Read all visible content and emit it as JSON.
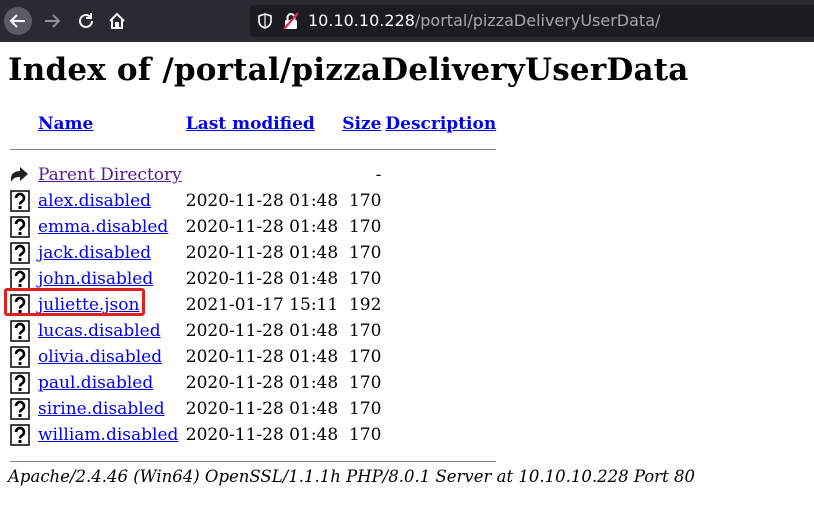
{
  "browser": {
    "url_host": "10.10.10.228",
    "url_path": "/portal/pizzaDeliveryUserData/"
  },
  "page": {
    "title": "Index of /portal/pizzaDeliveryUserData",
    "columns": {
      "name": "Name",
      "modified": "Last modified",
      "size": "Size",
      "description": "Description"
    },
    "parent": {
      "label": "Parent Directory",
      "size": "-"
    },
    "rows": [
      {
        "name": "alex.disabled",
        "modified": "2020-11-28 01:48",
        "size": "170"
      },
      {
        "name": "emma.disabled",
        "modified": "2020-11-28 01:48",
        "size": "170"
      },
      {
        "name": "jack.disabled",
        "modified": "2020-11-28 01:48",
        "size": "170"
      },
      {
        "name": "john.disabled",
        "modified": "2020-11-28 01:48",
        "size": "170"
      },
      {
        "name": "juliette.json",
        "modified": "2021-01-17 15:11",
        "size": "192"
      },
      {
        "name": "lucas.disabled",
        "modified": "2020-11-28 01:48",
        "size": "170"
      },
      {
        "name": "olivia.disabled",
        "modified": "2020-11-28 01:48",
        "size": "170"
      },
      {
        "name": "paul.disabled",
        "modified": "2020-11-28 01:48",
        "size": "170"
      },
      {
        "name": "sirine.disabled",
        "modified": "2020-11-28 01:48",
        "size": "170"
      },
      {
        "name": "william.disabled",
        "modified": "2020-11-28 01:48",
        "size": "170"
      }
    ],
    "footer": "Apache/2.4.46 (Win64) OpenSSL/1.1.1h PHP/8.0.1 Server at 10.10.10.228 Port 80"
  },
  "colors": {
    "toolbar": "#2b2a33",
    "urlbar": "#1c1b22",
    "link": "#0000ee",
    "visited": "#551a8b",
    "highlight": "#e0201f"
  },
  "icons": {
    "back": "arrow-left-icon",
    "forward": "arrow-right-icon",
    "reload": "reload-icon",
    "home": "home-icon",
    "file": "unknown-file-icon",
    "parent": "back-folder-icon"
  }
}
